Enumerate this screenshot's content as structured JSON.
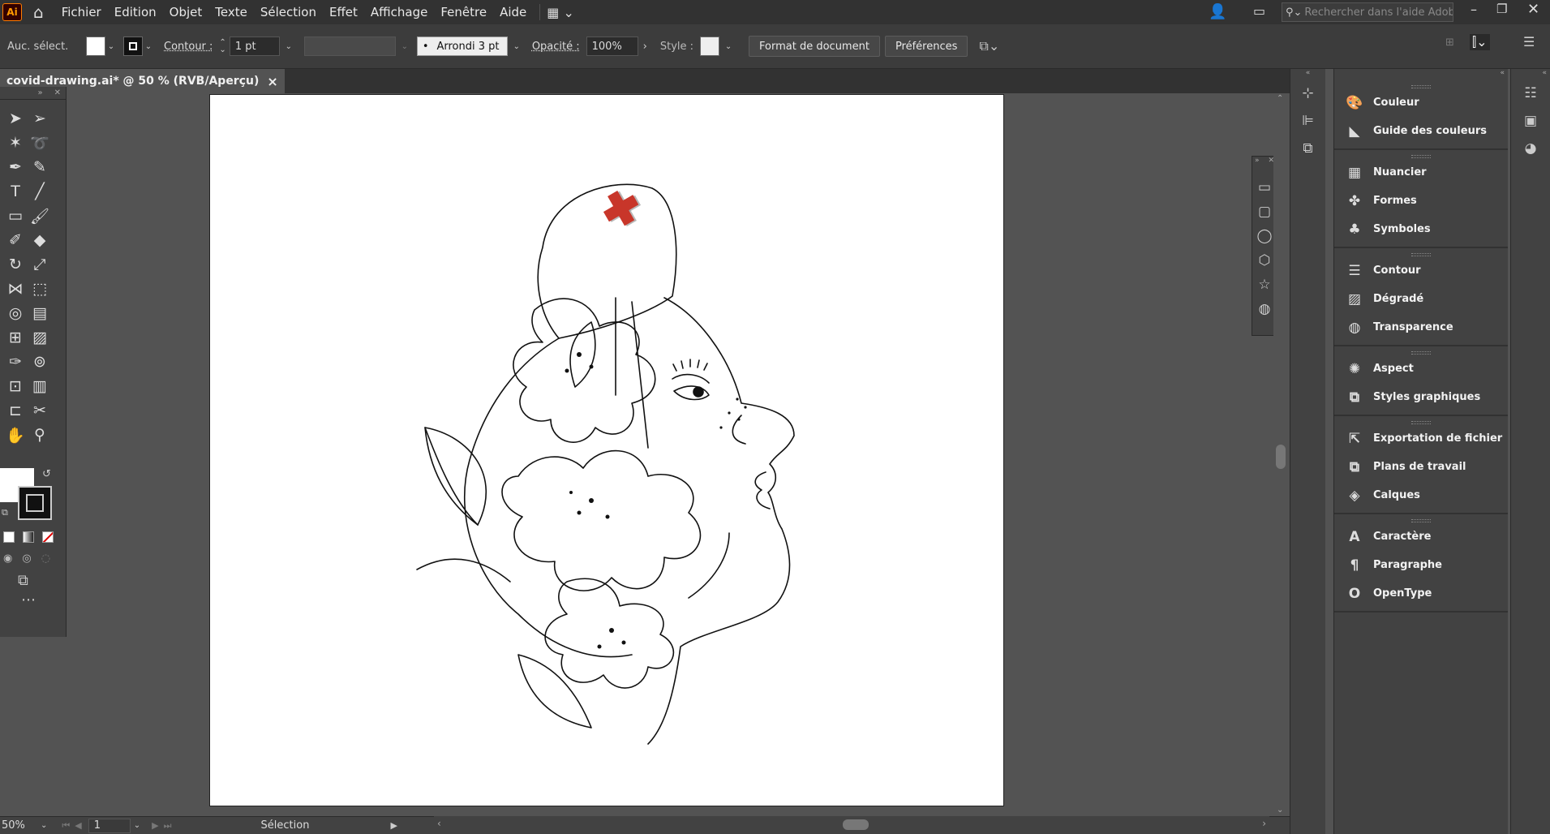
{
  "menubar": {
    "logo": "Ai",
    "items": [
      "Fichier",
      "Edition",
      "Objet",
      "Texte",
      "Sélection",
      "Effet",
      "Affichage",
      "Fenêtre",
      "Aide"
    ],
    "search_placeholder": "Rechercher dans l'aide Adobe"
  },
  "control": {
    "selection_label": "Auc. sélect.",
    "contour_label": "Contour :",
    "contour_value": "1 pt",
    "brush_label": "Arrondi 3 pt",
    "opacity_label": "Opacité :",
    "opacity_value": "100%",
    "style_label": "Style :",
    "doc_format_button": "Format de document",
    "prefs_button": "Préférences"
  },
  "document": {
    "tab_title": "covid-drawing.ai* @ 50 % (RVB/Aperçu)",
    "close_glyph": "×"
  },
  "status": {
    "zoom": "50%",
    "artboard": "1",
    "tool": "Sélection"
  },
  "panels": [
    {
      "items": [
        {
          "label": "Couleur",
          "icon": "palette-icon",
          "glyph": "🎨"
        },
        {
          "label": "Guide des couleurs",
          "icon": "color-guide-icon",
          "glyph": "◣"
        }
      ]
    },
    {
      "items": [
        {
          "label": "Nuancier",
          "icon": "swatches-icon",
          "glyph": "▦"
        },
        {
          "label": "Formes",
          "icon": "brushes-icon",
          "glyph": "✤"
        },
        {
          "label": "Symboles",
          "icon": "symbols-icon",
          "glyph": "♣"
        }
      ]
    },
    {
      "items": [
        {
          "label": "Contour",
          "icon": "stroke-icon",
          "glyph": "☰"
        },
        {
          "label": "Dégradé",
          "icon": "gradient-icon",
          "glyph": "▨"
        },
        {
          "label": "Transparence",
          "icon": "transparency-icon",
          "glyph": "◍"
        }
      ]
    },
    {
      "items": [
        {
          "label": "Aspect",
          "icon": "appearance-icon",
          "glyph": "✺"
        },
        {
          "label": "Styles graphiques",
          "icon": "graphic-styles-icon",
          "glyph": "⧉"
        }
      ]
    },
    {
      "items": [
        {
          "label": "Exportation de fichier",
          "icon": "export-icon",
          "glyph": "⇱"
        },
        {
          "label": "Plans de travail",
          "icon": "artboards-icon",
          "glyph": "⧉"
        },
        {
          "label": "Calques",
          "icon": "layers-icon",
          "glyph": "◈"
        }
      ]
    },
    {
      "items": [
        {
          "label": "Caractère",
          "icon": "character-icon",
          "glyph": "A"
        },
        {
          "label": "Paragraphe",
          "icon": "paragraph-icon",
          "glyph": "¶"
        },
        {
          "label": "OpenType",
          "icon": "opentype-icon",
          "glyph": "O"
        }
      ]
    }
  ],
  "colors": {
    "accent_red": "#c8362a",
    "ui_dark": "#323232",
    "ui_mid": "#424242",
    "canvas": "#535353"
  }
}
